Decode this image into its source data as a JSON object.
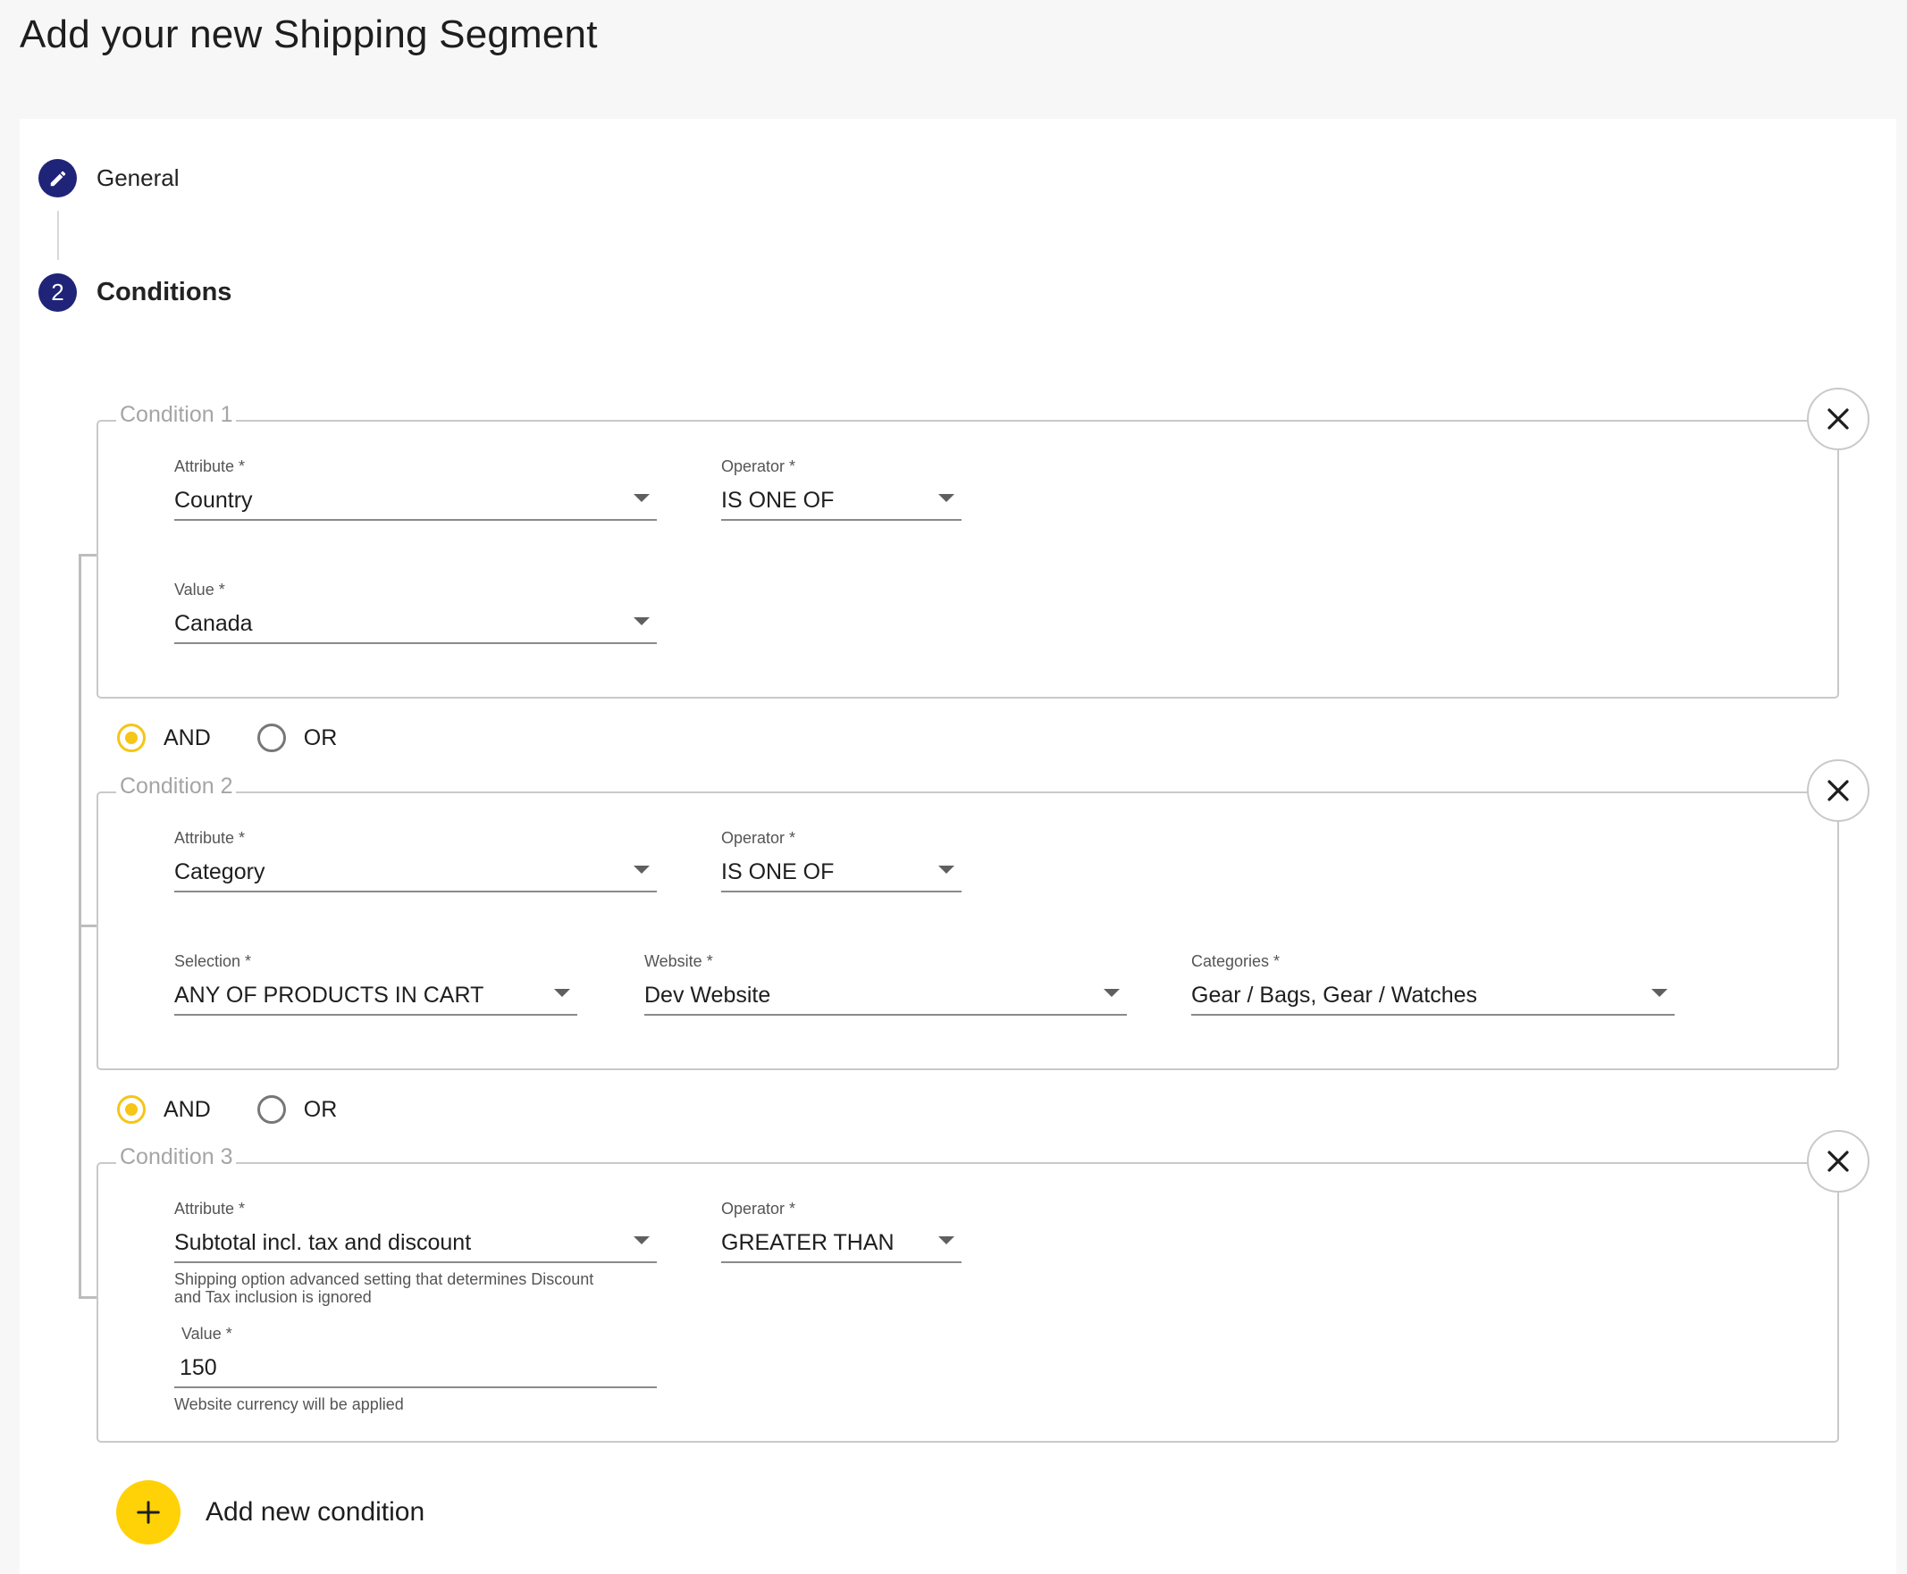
{
  "page": {
    "title": "Add your new Shipping Segment"
  },
  "stepper": {
    "steps": [
      {
        "label": "General",
        "icon": "pencil-icon"
      },
      {
        "label": "Conditions",
        "number": "2"
      }
    ]
  },
  "conditions": [
    {
      "legend": "Condition 1",
      "attribute": {
        "label": "Attribute *",
        "value": "Country"
      },
      "operator": {
        "label": "Operator *",
        "value": "IS ONE OF"
      },
      "value": {
        "label": "Value *",
        "value": "Canada"
      }
    },
    {
      "legend": "Condition 2",
      "attribute": {
        "label": "Attribute *",
        "value": "Category"
      },
      "operator": {
        "label": "Operator *",
        "value": "IS ONE OF"
      },
      "selection": {
        "label": "Selection *",
        "value": "ANY OF PRODUCTS IN CART"
      },
      "website": {
        "label": "Website *",
        "value": "Dev Website"
      },
      "categories": {
        "label": "Categories *",
        "value": "Gear / Bags, Gear / Watches"
      }
    },
    {
      "legend": "Condition 3",
      "attribute": {
        "label": "Attribute *",
        "value": "Subtotal incl. tax and discount",
        "helper_line1": "Shipping option advanced setting that determines Discount",
        "helper_line2": "and Tax inclusion is ignored"
      },
      "operator": {
        "label": "Operator *",
        "value": "GREATER THAN"
      },
      "value": {
        "label": "Value *",
        "value": "150",
        "helper": "Website currency will be applied"
      }
    }
  ],
  "logic": [
    {
      "and_label": "AND",
      "or_label": "OR",
      "selected": "AND"
    },
    {
      "and_label": "AND",
      "or_label": "OR",
      "selected": "AND"
    }
  ],
  "add_condition": {
    "label": "Add new condition"
  },
  "colors": {
    "primary": "#1f2478",
    "accent": "#ffd207",
    "radio_checked": "#f5c518"
  }
}
